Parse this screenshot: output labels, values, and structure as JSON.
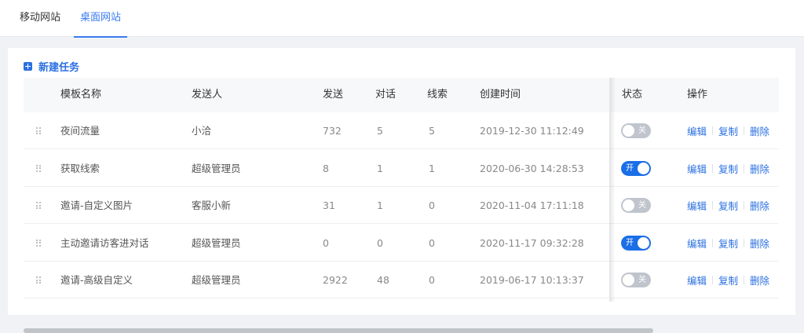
{
  "tabs": [
    {
      "label": "移动网站",
      "active": false
    },
    {
      "label": "桌面网站",
      "active": true
    }
  ],
  "new_task_label": "新建任务",
  "columns": [
    "模板名称",
    "发送人",
    "发送",
    "对话",
    "线索",
    "创建时间",
    "状态",
    "操作"
  ],
  "rows": [
    {
      "name": "夜间流量",
      "sender": "小洽",
      "sent": "732",
      "chats": "5",
      "leads": "5",
      "created": "2019-12-30 11:12:49",
      "status_on": false,
      "status_label": "关"
    },
    {
      "name": "获取线索",
      "sender": "超级管理员",
      "sent": "8",
      "chats": "1",
      "leads": "1",
      "created": "2020-06-30 14:28:53",
      "status_on": true,
      "status_label": "开"
    },
    {
      "name": "邀请-自定义图片",
      "sender": "客服小新",
      "sent": "31",
      "chats": "1",
      "leads": "0",
      "created": "2020-11-04 17:11:18",
      "status_on": false,
      "status_label": "关"
    },
    {
      "name": "主动邀请访客进对话",
      "sender": "超级管理员",
      "sent": "0",
      "chats": "0",
      "leads": "0",
      "created": "2020-11-17 09:32:28",
      "status_on": true,
      "status_label": "开"
    },
    {
      "name": "邀请-高级自定义",
      "sender": "超级管理员",
      "sent": "2922",
      "chats": "48",
      "leads": "0",
      "created": "2019-06-17 10:13:37",
      "status_on": false,
      "status_label": "关"
    }
  ],
  "actions": {
    "edit": "编辑",
    "copy": "复制",
    "delete": "删除"
  },
  "colors": {
    "accent": "#2a6fe0",
    "toggle_on": "#1a6ee6",
    "toggle_off": "#c0c4cc"
  }
}
